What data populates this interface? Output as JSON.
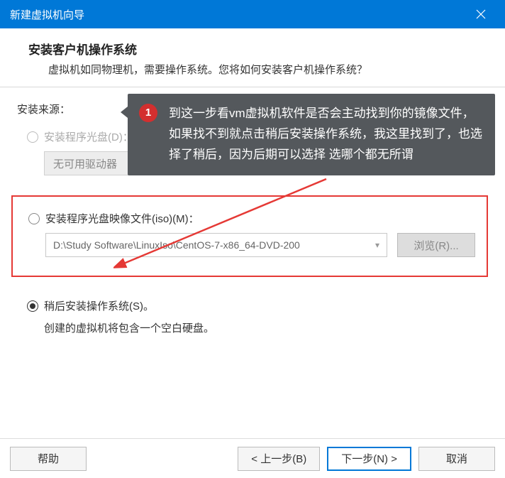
{
  "titlebar": {
    "title": "新建虚拟机向导"
  },
  "header": {
    "title": "安装客户机操作系统",
    "subtitle": "虚拟机如同物理机，需要操作系统。您将如何安装客户机操作系统？"
  },
  "section_label": "安装来源：",
  "option_disc": {
    "label": "安装程序光盘(D)：",
    "dropdown_text": "无可用驱动器"
  },
  "option_iso": {
    "label": "安装程序光盘映像文件(iso)(M)：",
    "path": "D:\\Study Software\\LinuxIso\\CentOS-7-x86_64-DVD-200",
    "browse": "浏览(R)..."
  },
  "option_later": {
    "label": "稍后安装操作系统(S)。",
    "desc": "创建的虚拟机将包含一个空白硬盘。"
  },
  "footer": {
    "help": "帮助",
    "back": "< 上一步(B)",
    "next": "下一步(N) >",
    "cancel": "取消"
  },
  "callout": {
    "badge": "1",
    "text": "到这一步看vm虚拟机软件是否会主动找到你的镜像文件，如果找不到就点击稍后安装操作系统，我这里找到了，也选择了稍后，因为后期可以选择 选哪个都无所谓"
  }
}
